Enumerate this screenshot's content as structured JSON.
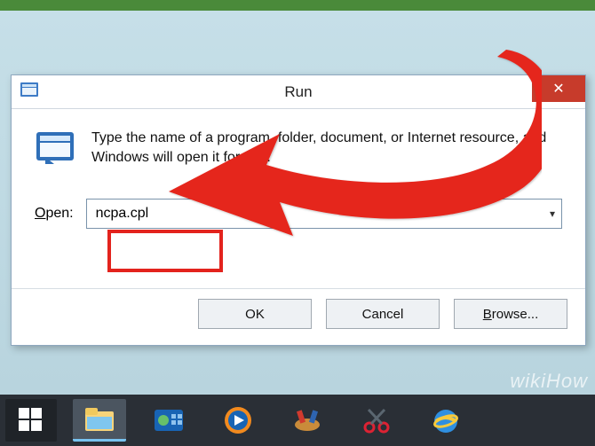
{
  "dialog": {
    "title": "Run",
    "description": "Type the name of a program, folder, document, or Internet resource, and Windows will open it for you.",
    "open_label": "Open:",
    "open_value": "ncpa.cpl",
    "buttons": {
      "ok": "OK",
      "cancel": "Cancel",
      "browse": "Browse..."
    },
    "close_glyph": "✕"
  },
  "watermark": "wikiHow",
  "taskbar": {
    "items": [
      "start",
      "file-explorer",
      "control-panel",
      "media-player",
      "snipping-tool",
      "screen-sketch",
      "internet-explorer"
    ]
  }
}
